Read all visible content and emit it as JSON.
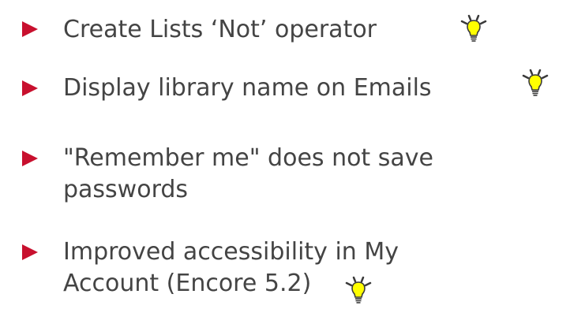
{
  "slide": {
    "items": [
      {
        "label": "Create Lists ‘Not’ operator",
        "has_idea_icon": true
      },
      {
        "label": "Display library name on Emails",
        "has_idea_icon": true
      },
      {
        "label": "\"Remember me\" does not save",
        "label_line2": "passwords",
        "has_idea_icon": false
      },
      {
        "label": "Improved accessibility in My",
        "label_line2": "Account (Encore 5.2)",
        "has_idea_icon": true
      }
    ]
  },
  "colors": {
    "bullet": "#c8102e",
    "text": "#444444",
    "bulb": "#ffff00",
    "bulb_outline": "#3a3a3a"
  },
  "icons": {
    "bullet": "red-triangle-bullet-icon",
    "idea": "lightbulb-idea-icon"
  }
}
